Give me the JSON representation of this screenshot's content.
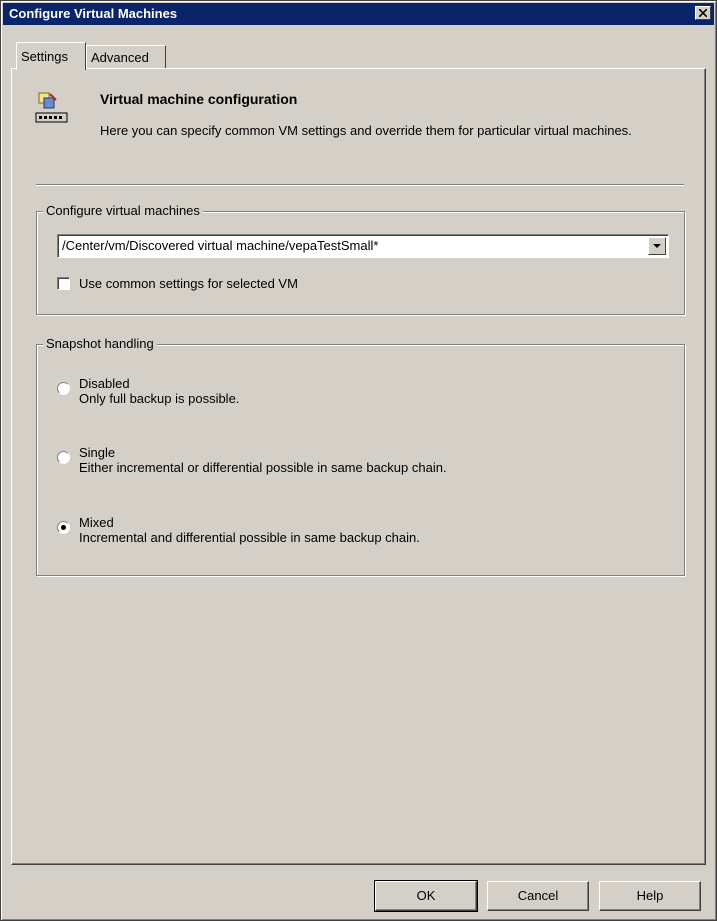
{
  "window": {
    "title": "Configure Virtual Machines"
  },
  "tabs": [
    {
      "label": "Settings",
      "active": true
    },
    {
      "label": "Advanced",
      "active": false
    }
  ],
  "header": {
    "title": "Virtual machine configuration",
    "description": "Here you can specify common VM settings and override them for particular virtual machines."
  },
  "vm_group": {
    "legend": "Configure virtual machines",
    "selected_vm": "/Center/vm/Discovered virtual machine/vepaTestSmall*",
    "common_settings_label": "Use common settings for selected VM",
    "common_settings_checked": false
  },
  "snapshot_group": {
    "legend": "Snapshot handling",
    "options": [
      {
        "title": "Disabled",
        "description": "Only full backup is possible.",
        "checked": false
      },
      {
        "title": "Single",
        "description": "Either incremental or differential possible in same backup chain.",
        "checked": false
      },
      {
        "title": "Mixed",
        "description": "Incremental and differential possible in same backup chain.",
        "checked": true
      }
    ]
  },
  "buttons": {
    "ok": "OK",
    "cancel": "Cancel",
    "help": "Help"
  },
  "icons": {
    "header": "vm-config-icon",
    "close": "close-icon",
    "dropdown": "chevron-down-icon"
  },
  "colors": {
    "titlebar": "#0a246a",
    "face": "#d4d0c8"
  }
}
